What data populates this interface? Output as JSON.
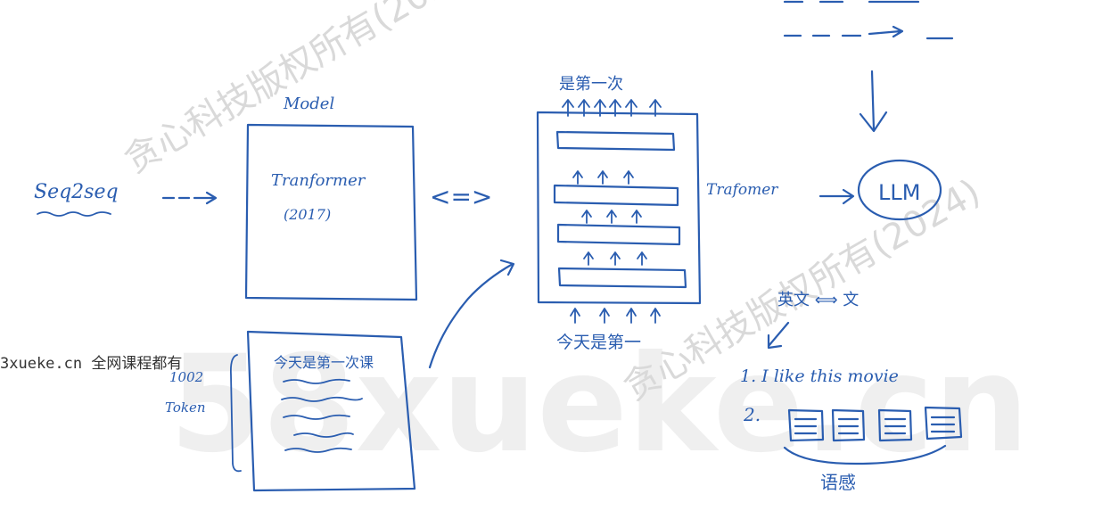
{
  "watermarks": {
    "main": "贪心科技版权所有(2024)",
    "secondary": "贪心科技版权所有(2024)",
    "large": "58xueke.cn",
    "site_prefix": "3xueke.cn",
    "site_suffix": "全网课程都有"
  },
  "labels": {
    "seq2seq": "Seq2seq",
    "model": "Model",
    "transformer": "Tranformer",
    "year": "(2017)",
    "equiv": "<=>",
    "output_tokens": "是第一次",
    "input_tokens": "今天是第一",
    "transformer_arrow": "Trafomer",
    "llm": "LLM",
    "doc_title": "今天是第一次课",
    "side_length": "1002",
    "side_token": "Token",
    "task_translate": "英文 ⟺ 文",
    "list_1": "1. I like this movie",
    "list_2": "2.",
    "corpus": "语感"
  },
  "colors": {
    "ink": "#2a5db0",
    "watermark": "#d9d9d9"
  }
}
